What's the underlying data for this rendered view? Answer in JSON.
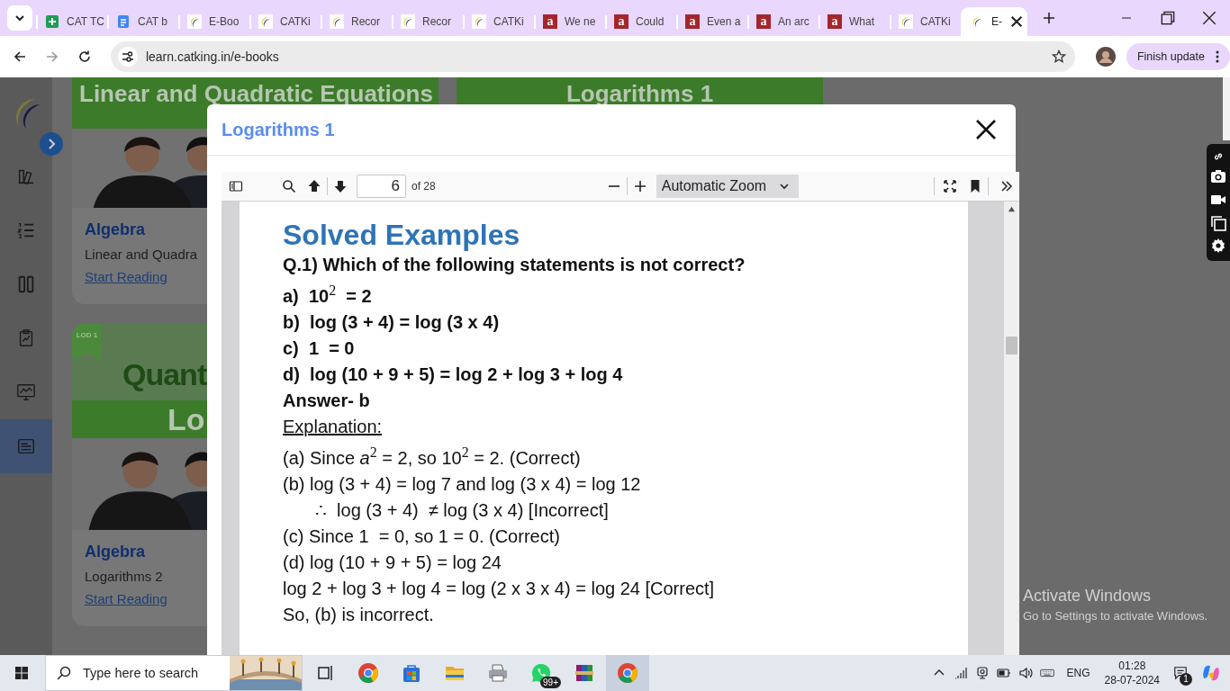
{
  "browser": {
    "tabs": [
      {
        "title": "CAT TC",
        "kind": "sheets",
        "selected": false
      },
      {
        "title": "CAT b",
        "kind": "docs",
        "selected": false
      },
      {
        "title": "E-Boo",
        "kind": "crescent",
        "selected": false
      },
      {
        "title": "CATKi",
        "kind": "crescent",
        "selected": false
      },
      {
        "title": "Recor",
        "kind": "crescent",
        "selected": false
      },
      {
        "title": "Recor",
        "kind": "crescent",
        "selected": false
      },
      {
        "title": "CATKi",
        "kind": "crescent",
        "selected": false
      },
      {
        "title": "We ne",
        "kind": "letter",
        "favicon_text": "a",
        "selected": false
      },
      {
        "title": "Could",
        "kind": "letter",
        "favicon_text": "a",
        "selected": false
      },
      {
        "title": "Even a",
        "kind": "letter",
        "favicon_text": "a",
        "selected": false
      },
      {
        "title": "An arc",
        "kind": "letter",
        "favicon_text": "a",
        "selected": false
      },
      {
        "title": "What",
        "kind": "letter",
        "favicon_text": "a",
        "selected": false
      },
      {
        "title": "CATKi",
        "kind": "crescent",
        "selected": false
      },
      {
        "title": "E-",
        "kind": "crescent",
        "selected": true
      }
    ],
    "address": "learn.catking.in/e-books",
    "update_button": "Finish update"
  },
  "sidebar": {
    "items": [
      {
        "kind": "books",
        "selected": false
      },
      {
        "kind": "list",
        "selected": false
      },
      {
        "kind": "columns",
        "selected": false
      },
      {
        "kind": "clipboard",
        "selected": false
      },
      {
        "kind": "monitor",
        "selected": false
      },
      {
        "kind": "ebook",
        "selected": true
      }
    ]
  },
  "cards": [
    {
      "header": "Linear and Quadratic Equations",
      "subject": "Algebra",
      "title": "Linear and Quadra",
      "link": "Start Reading"
    },
    {
      "badge": "LOD 1",
      "banner": "Quant",
      "band": "Lo",
      "subject": "Algebra",
      "title": "Logarithms 2",
      "link": "Start Reading"
    }
  ],
  "second_column": {
    "header": "Logarithms 1"
  },
  "modal": {
    "title": "Logarithms 1",
    "viewer": {
      "page": "6",
      "page_count": "of 28",
      "zoom": "Automatic Zoom",
      "lines": [
        {
          "kind": "heading",
          "text": "Solved Examples"
        },
        {
          "kind": "bold",
          "text": "Q.1) Which of the following statements is not correct?"
        },
        {
          "kind": "bold",
          "text": "a)  10$^{2}$  = 2"
        },
        {
          "kind": "bold",
          "text": "b)  log (3 + 4) = log (3 x 4)"
        },
        {
          "kind": "bold",
          "text": "c)  1  = 0"
        },
        {
          "kind": "bold",
          "text": "d)  log (10 + 9 + 5) = log 2 + log 3 + log 4"
        },
        {
          "kind": "bold",
          "text": "Answer- b"
        },
        {
          "kind": "underlined",
          "text": "Explanation:"
        },
        {
          "kind": "plain",
          "text": "(a) Since *a*$^{2}$ = 2, so 10$^{2}$ = 2. (Correct)"
        },
        {
          "kind": "plain",
          "text": "(b) log (3 + 4) = log 7 and log (3 x 4) = log 12"
        },
        {
          "kind": "indented",
          "text": "∴  log (3 + 4)  ≠ log (3 x 4) [Incorrect]"
        },
        {
          "kind": "plain",
          "text": "(c) Since 1  = 0, so 1 = 0. (Correct)"
        },
        {
          "kind": "plain",
          "text": "(d) log (10 + 9 + 5) = log 24"
        },
        {
          "kind": "plain",
          "text": "log 2 + log 3 + log 4 = log (2 x 3 x 4) = log 24 [Correct]"
        },
        {
          "kind": "plain",
          "text": "So, (b) is incorrect."
        }
      ]
    }
  },
  "activation": {
    "title": "Activate Windows",
    "subtitle": "Go to Settings to activate Windows."
  },
  "taskbar": {
    "search_placeholder": "Type here to search",
    "apps": [
      {
        "kind": "taskview",
        "selected": false
      },
      {
        "kind": "chrome",
        "selected": false
      },
      {
        "kind": "store",
        "selected": false
      },
      {
        "kind": "folder",
        "selected": false
      },
      {
        "kind": "printer",
        "selected": false
      },
      {
        "kind": "chat",
        "selected": false,
        "badge": "99+"
      },
      {
        "kind": "archive",
        "selected": false
      },
      {
        "kind": "chrome",
        "selected": true
      }
    ],
    "language": "ENG",
    "time": "01:28",
    "date": "28-07-2024",
    "notifications": "1"
  }
}
